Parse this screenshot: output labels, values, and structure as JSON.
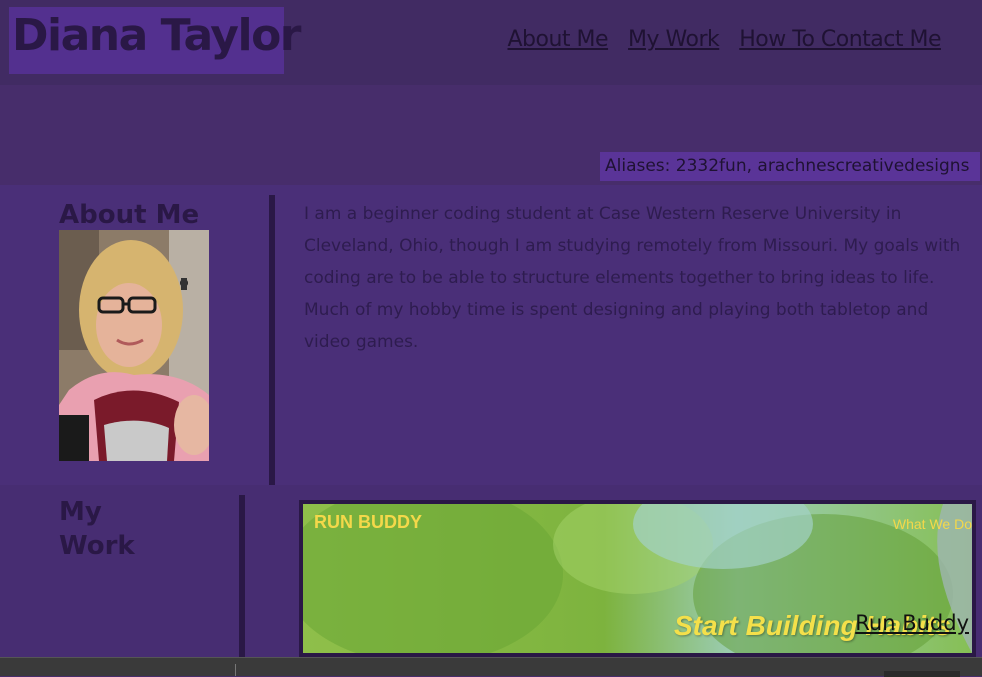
{
  "header": {
    "name": "Diana Taylor",
    "nav": [
      "About Me",
      "My Work",
      "How To Contact Me"
    ]
  },
  "hero": {
    "aliases": "Aliases: 2332fun, arachnescreativedesigns"
  },
  "about": {
    "title": "About Me",
    "text": "I am a beginner coding student at Case Western Reserve University in Cleveland, Ohio, though I am studying remotely from Missouri. My goals with coding are to be able to structure elements together to bring ideas to life. Much of my hobby time is spent designing and playing both tabletop and video games."
  },
  "work": {
    "title": "My Work",
    "project": {
      "logo": "RUN BUDDY",
      "nav": "What We Do",
      "headline": "Start Building Habits",
      "link": "Run Buddy"
    }
  },
  "colors": {
    "background": "#472d6b",
    "header": "#412b63",
    "logo_block": "#53308f",
    "alias_block": "#5a3498",
    "text_dark": "#2a1846",
    "accent_yellow": "#f4d84a"
  }
}
